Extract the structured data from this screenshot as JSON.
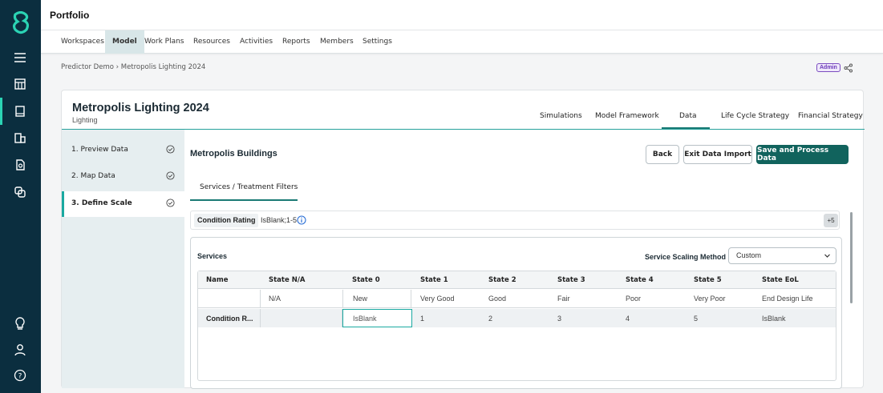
{
  "app": {
    "title": "Portfolio"
  },
  "nav_tabs": [
    {
      "label": "Workspaces",
      "active": false
    },
    {
      "label": "Model",
      "active": true
    },
    {
      "label": "Work Plans",
      "active": false
    },
    {
      "label": "Resources",
      "active": false
    },
    {
      "label": "Activities",
      "active": false
    },
    {
      "label": "Reports",
      "active": false
    },
    {
      "label": "Members",
      "active": false
    },
    {
      "label": "Settings",
      "active": false
    }
  ],
  "breadcrumb": "Predictor Demo › Metropolis Lighting 2024",
  "admin_badge": "Admin",
  "card": {
    "title": "Metropolis Lighting 2024",
    "subtitle": "Lighting",
    "tabs": [
      {
        "label": "Simulations",
        "active": false
      },
      {
        "label": "Model Framework",
        "active": false
      },
      {
        "label": "Data",
        "active": true
      },
      {
        "label": "Life Cycle Strategy",
        "active": false
      },
      {
        "label": "Financial Strategy",
        "active": false
      }
    ]
  },
  "steps": [
    {
      "label": "1. Preview Data",
      "done": true,
      "active": false
    },
    {
      "label": "2. Map Data",
      "done": true,
      "active": false
    },
    {
      "label": "3. Define Scale",
      "done": true,
      "active": true
    }
  ],
  "main": {
    "title": "Metropolis Buildings",
    "buttons": {
      "back": "Back",
      "exit": "Exit Data Import",
      "save": "Save and Process Data"
    },
    "subtab": "Services / Treatment Filters",
    "filter": {
      "chip": "Condition Rating",
      "value": "IsBlank;1-5",
      "more": "+5"
    }
  },
  "services": {
    "title": "Services",
    "scaling_label": "Service Scaling Method",
    "scaling_value": "Custom",
    "columns": [
      "Name",
      "State N/A",
      "State 0",
      "State 1",
      "State 2",
      "State 3",
      "State 4",
      "State 5",
      "State EoL"
    ],
    "subheader": [
      "",
      "N/A",
      "New",
      "Very Good",
      "Good",
      "Fair",
      "Poor",
      "Very Poor",
      "End Design Life"
    ],
    "rows": [
      {
        "cells": [
          "Condition R...",
          "",
          "IsBlank",
          "1",
          "2",
          "3",
          "4",
          "5",
          "IsBlank"
        ]
      }
    ]
  },
  "colors": {
    "rail": "#0b2e3f",
    "accent": "#1aa9a1",
    "primary": "#11635d",
    "admin": "#6a37b8"
  }
}
